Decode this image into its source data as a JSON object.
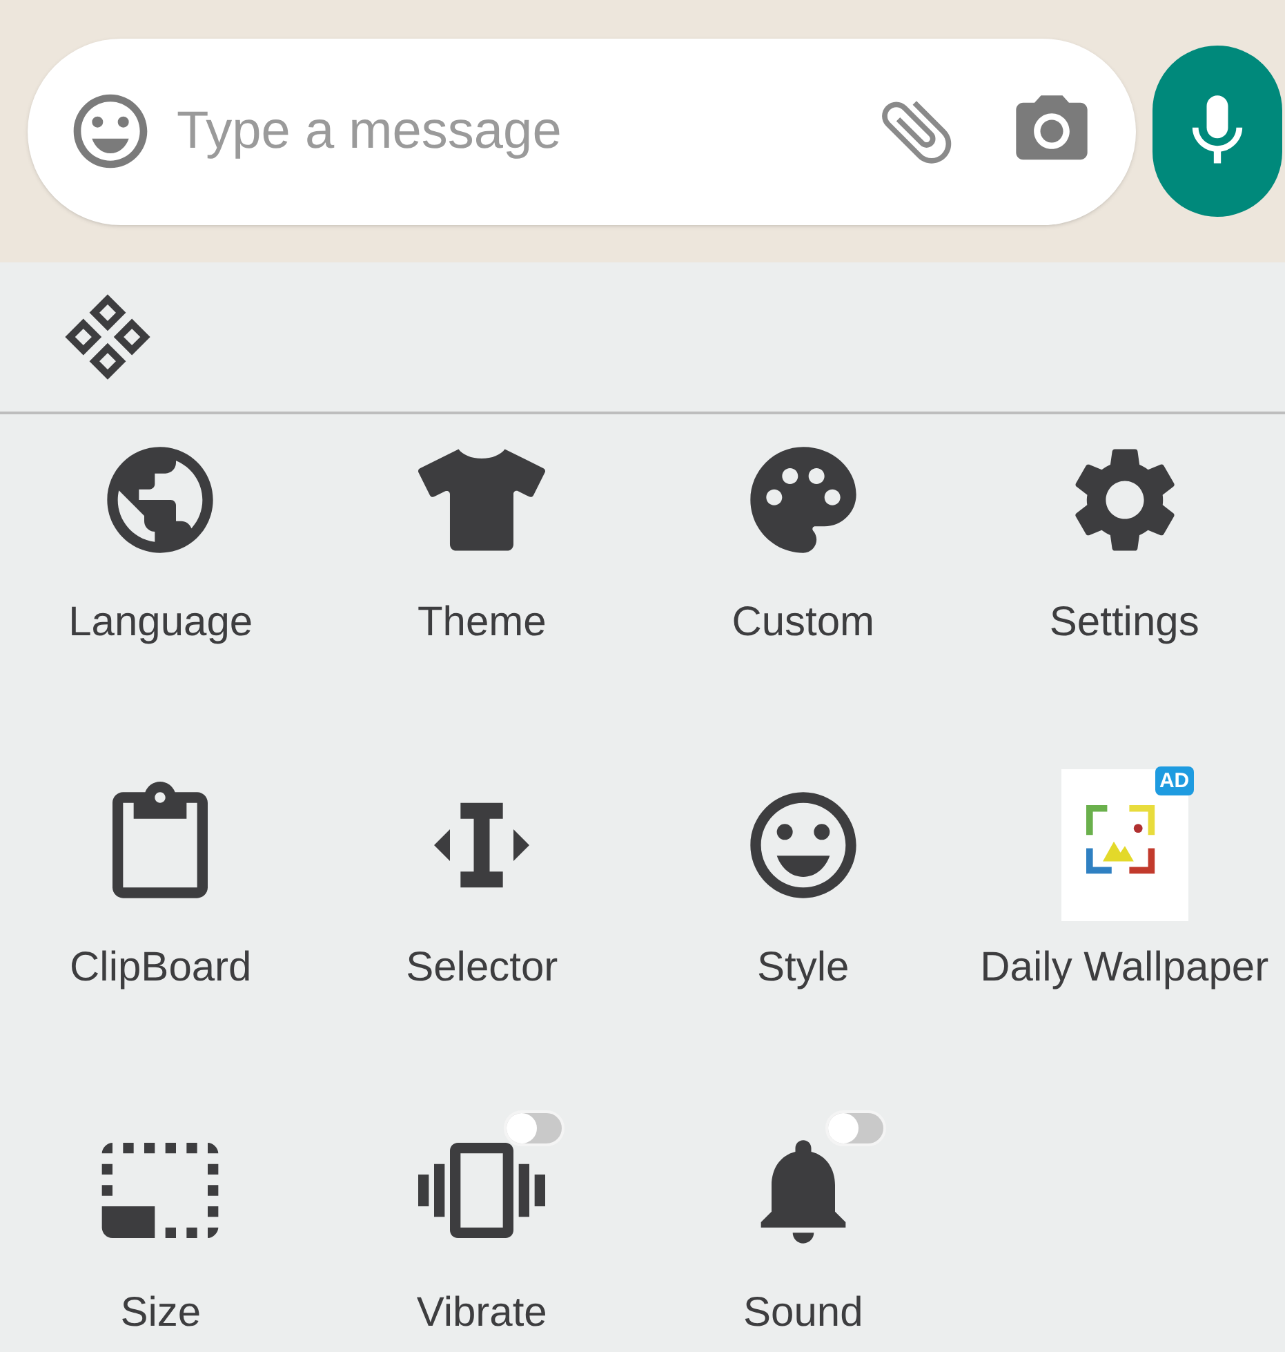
{
  "composer": {
    "placeholder": "Type a message"
  },
  "tools": [
    {
      "kind": "icon",
      "label": "Language"
    },
    {
      "kind": "icon",
      "label": "Theme"
    },
    {
      "kind": "icon",
      "label": "Custom"
    },
    {
      "kind": "icon",
      "label": "Settings"
    },
    {
      "kind": "icon",
      "label": "ClipBoard"
    },
    {
      "kind": "icon",
      "label": "Selector"
    },
    {
      "kind": "icon",
      "label": "Style"
    },
    {
      "kind": "ad",
      "label": "Daily Wallpaper",
      "badge": "AD"
    },
    {
      "kind": "icon",
      "label": "Size"
    },
    {
      "kind": "toggle",
      "label": "Vibrate",
      "on": false
    },
    {
      "kind": "toggle",
      "label": "Sound",
      "on": false
    }
  ]
}
